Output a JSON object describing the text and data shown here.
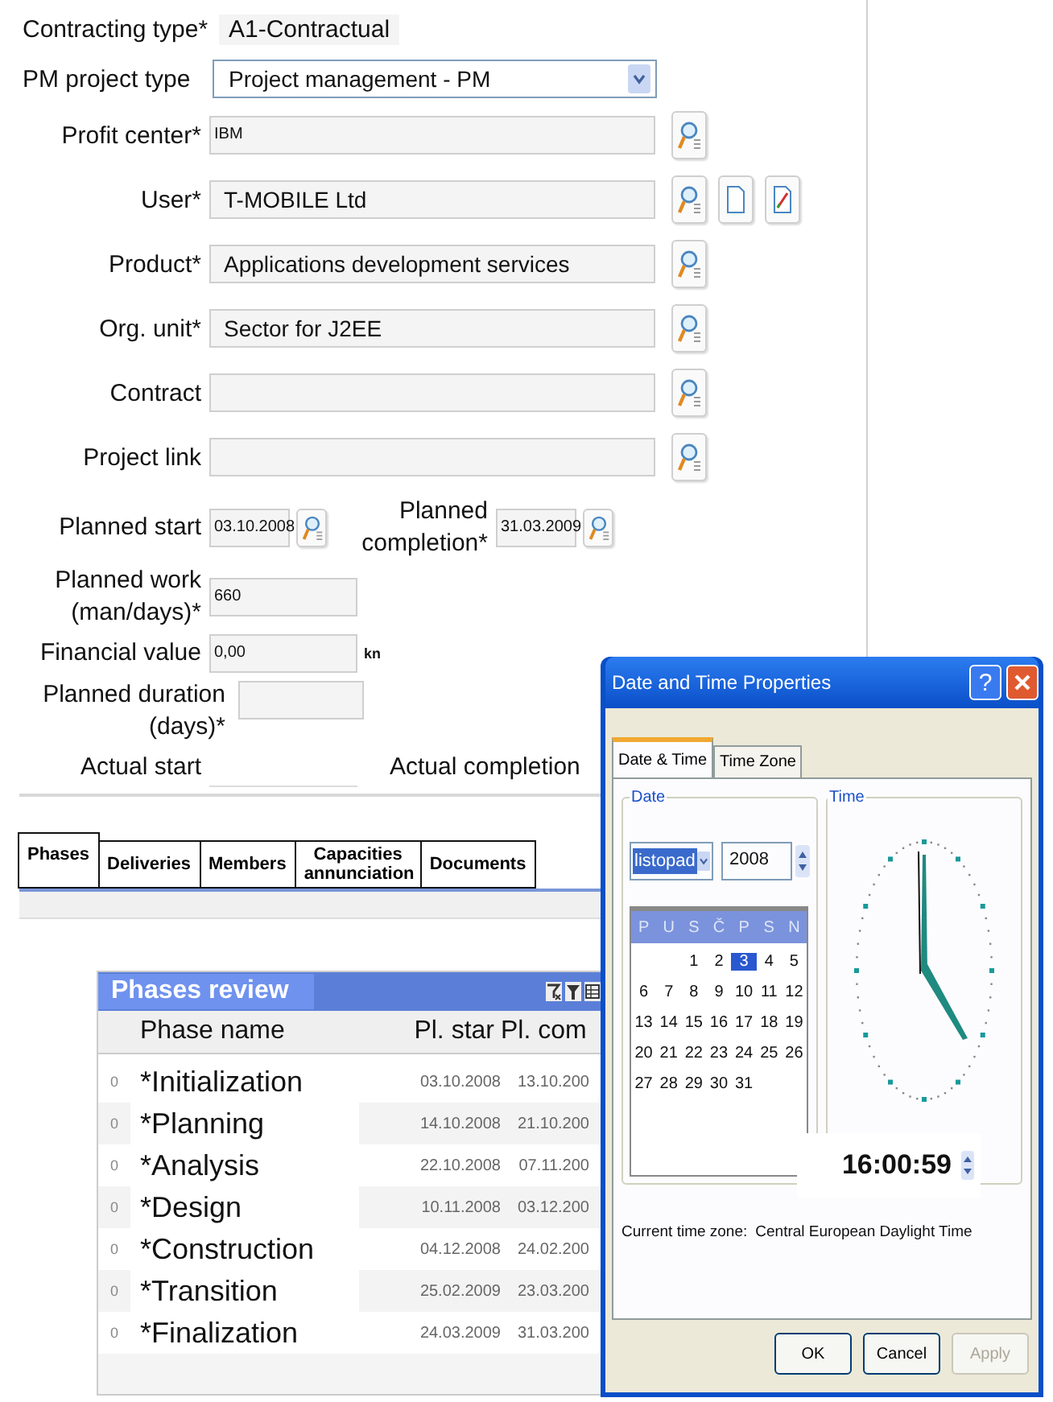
{
  "form": {
    "fields": [
      {
        "kind": "static",
        "label": "Contracting type*",
        "value": "A1-Contractual"
      },
      {
        "kind": "select",
        "label": "PM project type",
        "value": "Project management - PM"
      },
      {
        "kind": "lookup",
        "label": "Profit center*",
        "value": "IBM"
      },
      {
        "kind": "lookup_new_edit",
        "label": "User*",
        "value": "T-MOBILE Ltd"
      },
      {
        "kind": "lookup",
        "label": "Product*",
        "value": "Applications development services"
      },
      {
        "kind": "lookup",
        "label": "Org. unit*",
        "value": "Sector for J2EE"
      },
      {
        "kind": "lookup",
        "label": "Contract"
      },
      {
        "kind": "lookup",
        "label": "Project link"
      }
    ],
    "planned_start": {
      "label": "Planned start",
      "value": "03.10.2008"
    },
    "planned_completion": {
      "label": "Planned\ncompletion*",
      "value": "31.03.2009"
    },
    "planned_work": {
      "label": "Planned work\n(man/days)*",
      "value": "660"
    },
    "financial_value": {
      "label": "Financial value",
      "value": "0,00",
      "unit": "kn"
    },
    "planned_duration": {
      "label": "Planned duration\n(days)*"
    },
    "actual_start": {
      "label": "Actual start"
    },
    "actual_completion": {
      "label": "Actual completion"
    }
  },
  "tabs": [
    {
      "label": "Phases",
      "selected": true
    },
    {
      "label": "Deliveries",
      "selected": false
    },
    {
      "label": "Members",
      "selected": false
    },
    {
      "label": "Capacities annunciation",
      "selected": false
    },
    {
      "label": "Documents",
      "selected": false
    }
  ],
  "phases": {
    "title": "Phases review",
    "columns": [
      "Phase name",
      "Pl. star",
      "Pl. com"
    ],
    "rows": [
      {
        "marker": "0",
        "name": "*Initialization",
        "start": "03.10.2008",
        "completion": "13.10.200"
      },
      {
        "marker": "0",
        "name": "*Planning",
        "start": "14.10.2008",
        "completion": "21.10.200"
      },
      {
        "marker": "0",
        "name": "*Analysis",
        "start": "22.10.2008",
        "completion": "07.11.200"
      },
      {
        "marker": "0",
        "name": "*Design",
        "start": "10.11.2008",
        "completion": "03.12.200"
      },
      {
        "marker": "0",
        "name": "*Construction",
        "start": "04.12.2008",
        "completion": "24.02.200"
      },
      {
        "marker": "0",
        "name": "*Transition",
        "start": "25.02.2009",
        "completion": "23.03.200"
      },
      {
        "marker": "0",
        "name": "*Finalization",
        "start": "24.03.2009",
        "completion": "31.03.200"
      }
    ]
  },
  "dialog": {
    "title": "Date and Time Properties",
    "help": "?",
    "tabs": [
      {
        "label": "Date & Time",
        "selected": true
      },
      {
        "label": "Time Zone",
        "selected": false
      }
    ],
    "date_group": "Date",
    "month": "listopad",
    "year": "2008",
    "weekdays": [
      "P",
      "U",
      "S",
      "Č",
      "P",
      "S",
      "N"
    ],
    "weeks": [
      {
        "kind": "first",
        "days": [
          {
            "day": "1",
            "selected": false
          },
          {
            "day": "2",
            "selected": false
          },
          {
            "day": "3",
            "selected": true
          },
          {
            "day": "4",
            "selected": false
          },
          {
            "day": "5",
            "selected": false
          }
        ]
      },
      {
        "kind": "full",
        "days": [
          {
            "day": "6",
            "selected": false
          },
          {
            "day": "7",
            "selected": false
          },
          {
            "day": "8",
            "selected": false
          },
          {
            "day": "9",
            "selected": false
          },
          {
            "day": "10",
            "selected": false
          },
          {
            "day": "11",
            "selected": false
          },
          {
            "day": "12",
            "selected": false
          }
        ]
      },
      {
        "kind": "full",
        "days": [
          {
            "day": "13",
            "selected": false
          },
          {
            "day": "14",
            "selected": false
          },
          {
            "day": "15",
            "selected": false
          },
          {
            "day": "16",
            "selected": false
          },
          {
            "day": "17",
            "selected": false
          },
          {
            "day": "18",
            "selected": false
          },
          {
            "day": "19",
            "selected": false
          }
        ]
      },
      {
        "kind": "full",
        "days": [
          {
            "day": "20",
            "selected": false
          },
          {
            "day": "21",
            "selected": false
          },
          {
            "day": "22",
            "selected": false
          },
          {
            "day": "23",
            "selected": false
          },
          {
            "day": "24",
            "selected": false
          },
          {
            "day": "25",
            "selected": false
          },
          {
            "day": "26",
            "selected": false
          }
        ]
      },
      {
        "kind": "last",
        "days": [
          {
            "day": "27",
            "selected": false
          },
          {
            "day": "28",
            "selected": false
          },
          {
            "day": "29",
            "selected": false
          },
          {
            "day": "30",
            "selected": false
          },
          {
            "day": "31",
            "selected": false
          }
        ]
      }
    ],
    "time_group": "Time",
    "time": "16:00:59",
    "timezone_label": "Current time zone:",
    "timezone": "Central European Daylight Time",
    "buttons": [
      {
        "label": "OK",
        "disabled": false
      },
      {
        "label": "Cancel",
        "disabled": false
      },
      {
        "label": "Apply",
        "disabled": true
      }
    ]
  }
}
